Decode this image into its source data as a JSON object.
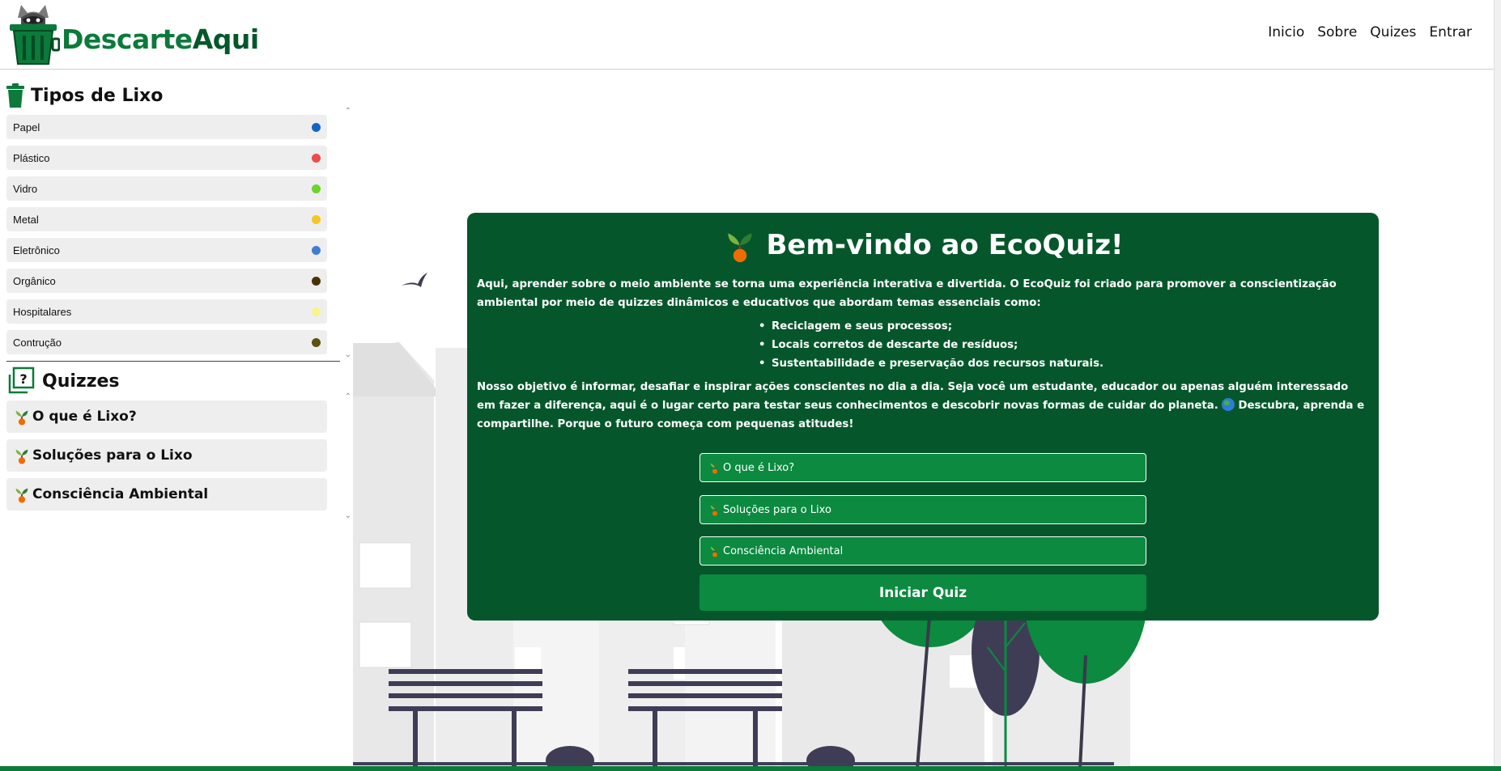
{
  "brand": {
    "name_part1": "Descarte",
    "name_part2": "Aqui",
    "color_primary": "#0b7a3b",
    "color_dark": "#05572b"
  },
  "nav": {
    "items": [
      "Inicio",
      "Sobre",
      "Quizes",
      "Entrar"
    ]
  },
  "sidebar": {
    "waste_title": "Tipos de Lixo",
    "waste_types": [
      {
        "label": "Papel",
        "color": "#1565c0"
      },
      {
        "label": "Plástico",
        "color": "#ef4b4b"
      },
      {
        "label": "Vidro",
        "color": "#6ad62a"
      },
      {
        "label": "Metal",
        "color": "#f5c624"
      },
      {
        "label": "Eletrônico",
        "color": "#3f7fd1"
      },
      {
        "label": "Orgânico",
        "color": "#4a3306"
      },
      {
        "label": "Hospitalares",
        "color": "#f6f58a"
      },
      {
        "label": "Contrução",
        "color": "#5c520e"
      }
    ],
    "quiz_title": "Quizzes",
    "quizzes": [
      "O que é Lixo?",
      "Soluções para o Lixo",
      "Consciência Ambiental"
    ]
  },
  "card": {
    "title": "Bem-vindo ao EcoQuiz!",
    "intro": "Aqui, aprender sobre o meio ambiente se torna uma experiência interativa e divertida. O EcoQuiz foi criado para promover a conscientização ambiental por meio de quizzes dinâmicos e educativos que abordam temas essenciais como:",
    "topics": [
      "Reciclagem e seus processos;",
      "Locais corretos de descarte de resíduos;",
      "Sustentabilidade e preservação dos recursos naturais."
    ],
    "outro_part1": "Nosso objetivo é informar, desafiar e inspirar ações conscientes no dia a dia. Seja você um estudante, educador ou apenas alguém interessado em fazer a diferença, aqui é o lugar certo para testar seus conhecimentos e descobrir novas formas de cuidar do planeta.",
    "outro_part2": "Descubra, aprenda e compartilhe. Porque o futuro começa com pequenas atitudes!",
    "options": [
      "O que é Lixo?",
      "Soluções para o Lixo",
      "Consciência Ambiental"
    ],
    "start_label": "Iniciar Quiz"
  }
}
